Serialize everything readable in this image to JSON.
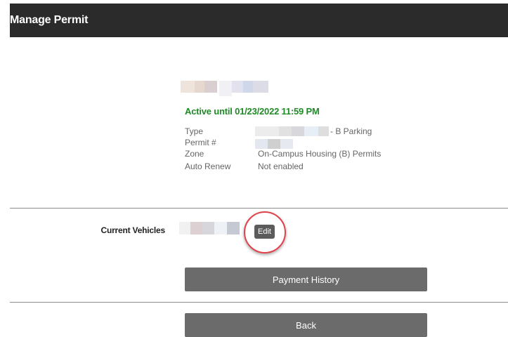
{
  "header": {
    "title": "Manage Permit"
  },
  "permit": {
    "status": "Active until 01/23/2022 11:59 PM",
    "details": [
      {
        "label": "Type",
        "value": "- B Parking"
      },
      {
        "label": "Permit #",
        "value": ""
      },
      {
        "label": "Zone",
        "value": "On-Campus Housing (B) Permits"
      },
      {
        "label": "Auto Renew",
        "value": "Not enabled"
      }
    ]
  },
  "vehicles": {
    "label": "Current Vehicles",
    "edit_label": "Edit"
  },
  "buttons": {
    "payment_history": "Payment History",
    "back": "Back"
  },
  "colors": {
    "header_bg": "#2b2b2b",
    "status_green": "#1f8a26",
    "button_gray": "#6b6b6b",
    "highlight_red": "#e0414a"
  }
}
